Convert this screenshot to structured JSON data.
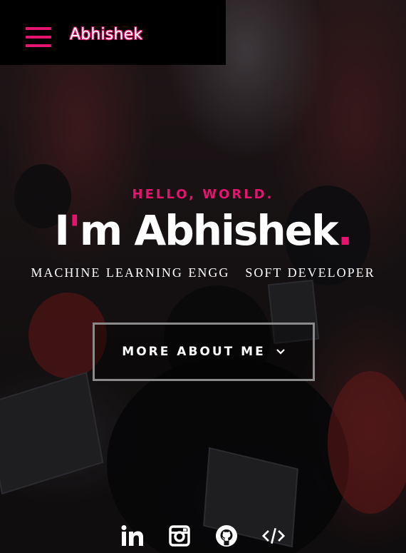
{
  "nav": {
    "brand": "Abhishek",
    "menu_icon": "hamburger-menu-icon"
  },
  "hero": {
    "greeting": "HELLO, WORLD.",
    "headline_prefix": "I",
    "headline_apostrophe": "'",
    "headline_main": "m Abhishek",
    "headline_dot": ".",
    "roles": [
      "MACHINE LEARNING ENGG",
      "SOFT DEVELOPER"
    ],
    "cta_label": "MORE ABOUT ME",
    "cta_icon": "chevron-down-icon"
  },
  "social": [
    {
      "name": "linkedin-icon"
    },
    {
      "name": "instagram-icon"
    },
    {
      "name": "github-icon"
    },
    {
      "name": "code-icon"
    }
  ],
  "colors": {
    "accent": "#e6136f",
    "topbar_bg": "#000000",
    "text": "#ffffff",
    "button_border": "#8a8a8a"
  }
}
